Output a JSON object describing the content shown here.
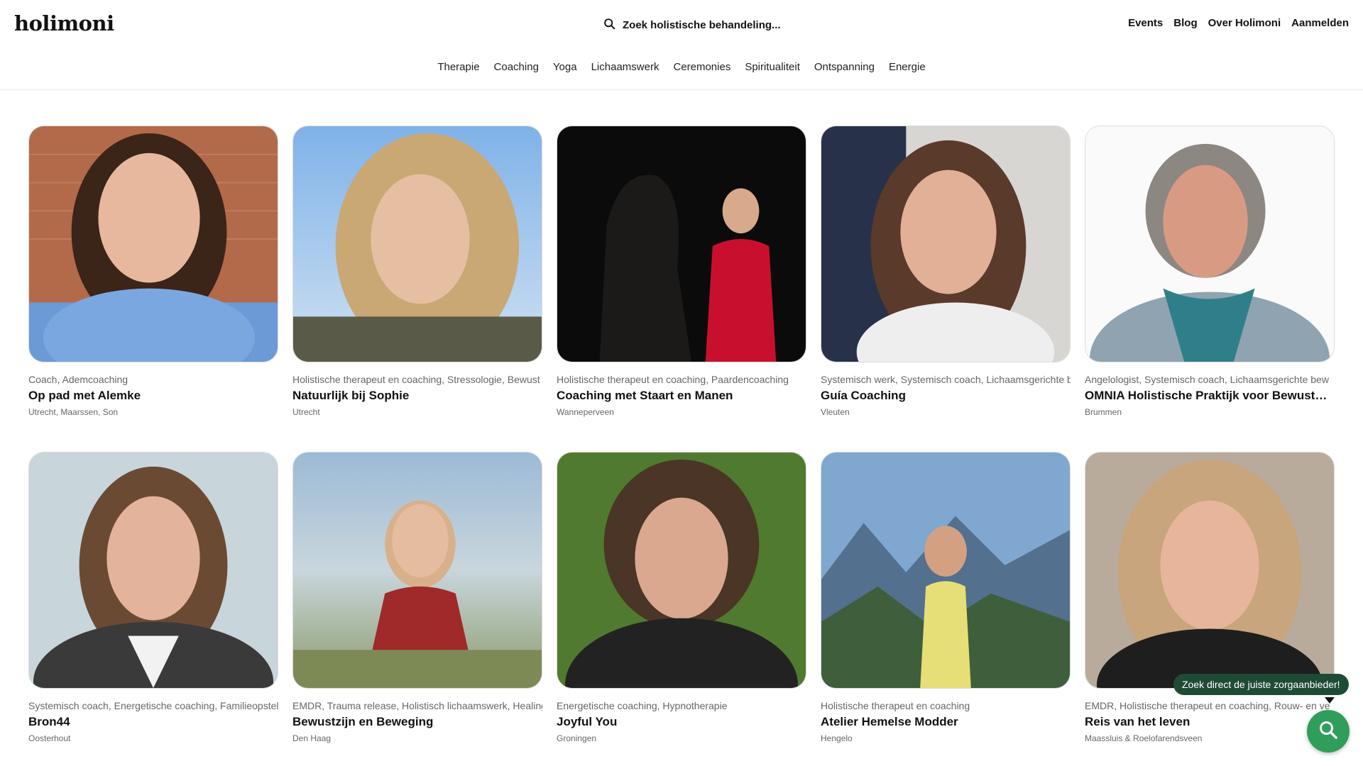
{
  "header": {
    "logo": "holimoni",
    "search_label": "Zoek holistische behandeling...",
    "nav": [
      "Events",
      "Blog",
      "Over Holimoni",
      "Aanmelden"
    ],
    "categories": [
      "Therapie",
      "Coaching",
      "Yoga",
      "Lichaamswerk",
      "Ceremonies",
      "Spiritualiteit",
      "Ontspanning",
      "Energie"
    ]
  },
  "cards": [
    {
      "categories": "Coach, Ademcoaching",
      "name": "Op pad met Alemke",
      "location": "Utrecht, Maarssen, Son"
    },
    {
      "categories": "Holistische therapeut en coaching, Stressologie, Bewust",
      "name": "Natuurlijk bij Sophie",
      "location": "Utrecht"
    },
    {
      "categories": "Holistische therapeut en coaching, Paardencoaching",
      "name": "Coaching met Staart en Manen",
      "location": "Wanneperveen"
    },
    {
      "categories": "Systemisch werk, Systemisch coach, Lichaamsgerichte b",
      "name": "Guía Coaching",
      "location": "Vleuten"
    },
    {
      "categories": "Angelologist, Systemisch coach, Lichaamsgerichte bew",
      "name": "OMNIA Holistische Praktijk voor Bewustwo...",
      "location": "Brummen"
    },
    {
      "categories": "Systemisch coach, Energetische coaching, Familieopstell",
      "name": "Bron44",
      "location": "Oosterhout"
    },
    {
      "categories": "EMDR, Trauma release, Holistisch lichaamswerk, Healing,",
      "name": "Bewustzijn en Beweging",
      "location": "Den Haag"
    },
    {
      "categories": "Energetische coaching, Hypnotherapie",
      "name": "Joyful You",
      "location": "Groningen"
    },
    {
      "categories": "Holistische therapeut en coaching",
      "name": "Atelier Hemelse Modder",
      "location": "Hengelo"
    },
    {
      "categories": "EMDR, Holistische therapeut en coaching, Rouw- en ve",
      "name": "Reis van het leven",
      "location": "Maassluis & Roelofarendsveen"
    }
  ],
  "floating": {
    "tooltip": "Zoek direct de juiste zorgaanbieder!"
  },
  "colors": {
    "brand_green": "#2f9e5b",
    "tooltip_bg": "#1f4b35"
  }
}
